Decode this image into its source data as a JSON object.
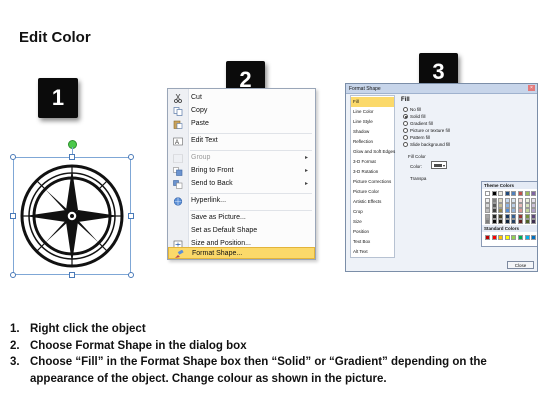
{
  "title": "Edit Color",
  "steps": [
    "1",
    "2",
    "3"
  ],
  "context_menu": {
    "items": [
      {
        "label": "Cut",
        "icon": "cut-icon",
        "disabled": false,
        "submenu": false
      },
      {
        "label": "Copy",
        "icon": "copy-icon",
        "disabled": false,
        "submenu": false
      },
      {
        "label": "Paste",
        "icon": "paste-icon",
        "disabled": false,
        "submenu": false
      },
      {
        "label": "Edit Text",
        "icon": "edit-text-icon",
        "disabled": false,
        "submenu": false
      },
      {
        "label": "Group",
        "icon": "group-icon",
        "disabled": true,
        "submenu": true
      },
      {
        "label": "Bring to Front",
        "icon": "bring-to-front-icon",
        "disabled": false,
        "submenu": true
      },
      {
        "label": "Send to Back",
        "icon": "send-to-back-icon",
        "disabled": false,
        "submenu": true
      },
      {
        "label": "Hyperlink...",
        "icon": "hyperlink-icon",
        "disabled": false,
        "submenu": false
      },
      {
        "label": "Save as Picture...",
        "icon": "",
        "disabled": false,
        "submenu": false
      },
      {
        "label": "Set as Default Shape",
        "icon": "",
        "disabled": false,
        "submenu": false
      },
      {
        "label": "Size and Position...",
        "icon": "size-position-icon",
        "disabled": false,
        "submenu": false
      },
      {
        "label": "Format Shape...",
        "icon": "format-shape-icon",
        "disabled": false,
        "submenu": false,
        "highlighted": true
      }
    ]
  },
  "dialog": {
    "title": "Format Shape",
    "close_glyph": "×",
    "categories": [
      "Fill",
      "Line Color",
      "Line Style",
      "Shadow",
      "Reflection",
      "Glow and Soft Edges",
      "3-D Format",
      "3-D Rotation",
      "Picture Corrections",
      "Picture Color",
      "Artistic Effects",
      "Crop",
      "Size",
      "Position",
      "Text Box",
      "Alt Text"
    ],
    "selected_category": "Fill",
    "fill_heading": "Fill",
    "fill_options": [
      "No fill",
      "Solid fill",
      "Gradient fill",
      "Picture or texture fill",
      "Pattern fill",
      "Slide background fill"
    ],
    "selected_fill": "Solid fill",
    "fill_color_heading": "Fill Color",
    "color_label": "Color:",
    "transparency_label": "Transpa",
    "theme_colors_heading": "Theme Colors",
    "standard_colors_heading": "Standard Colors",
    "theme_top_row": [
      "#ffffff",
      "#000000",
      "#eeece1",
      "#1f497d",
      "#4f81bd",
      "#c0504d",
      "#9bbb59",
      "#8064a2",
      "#4bacc6",
      "#f79646"
    ],
    "theme_shades": [
      [
        "#f2f2f2",
        "#7f7f7f",
        "#ddd9c3",
        "#c6d9f0",
        "#dbe5f1",
        "#f2dcdb",
        "#ebf1dd",
        "#e5e0ec",
        "#dbeef3",
        "#fdeada"
      ],
      [
        "#d8d8d8",
        "#595959",
        "#c4bd97",
        "#8db3e2",
        "#b8cce4",
        "#e5b9b7",
        "#d7e3bc",
        "#ccc1d9",
        "#b7dde8",
        "#fbd5b5"
      ],
      [
        "#bfbfbf",
        "#3f3f3f",
        "#938953",
        "#548dd4",
        "#95b3d7",
        "#d99694",
        "#c3d69b",
        "#b2a2c7",
        "#92cddc",
        "#fac08f"
      ],
      [
        "#a5a5a5",
        "#262626",
        "#494429",
        "#17365d",
        "#366092",
        "#953734",
        "#76923c",
        "#5f497a",
        "#31859b",
        "#e36c09"
      ],
      [
        "#7f7f7f",
        "#0c0c0c",
        "#1d1b10",
        "#0f243e",
        "#244061",
        "#632423",
        "#4f6128",
        "#3f3151",
        "#205867",
        "#974806"
      ]
    ],
    "standard_colors": [
      "#c00000",
      "#ff0000",
      "#ffc000",
      "#ffff00",
      "#92d050",
      "#00b050",
      "#00b0f0",
      "#0070c0",
      "#002060",
      "#7030a0"
    ],
    "close_button": "Close"
  },
  "instructions": [
    {
      "num": "1.",
      "text": "Right click the object"
    },
    {
      "num": "2.",
      "text": "Choose Format Shape in the dialog box"
    },
    {
      "num": "3.",
      "text": "Choose “Fill” in the Format Shape box then “Solid” or “Gradient” depending on the appearance of the object. Change colour as shown in the picture."
    }
  ]
}
